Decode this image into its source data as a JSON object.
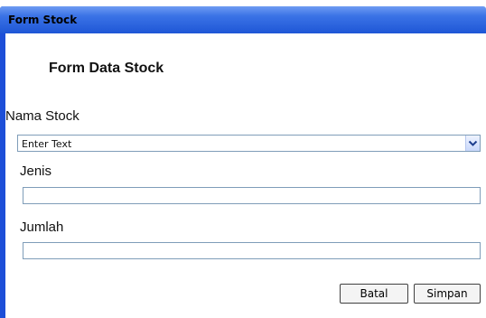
{
  "window": {
    "title": "Form Stock"
  },
  "form": {
    "heading": "Form Data Stock",
    "nama_stock": {
      "label": "Nama Stock",
      "value": "Enter Text"
    },
    "jenis": {
      "label": "Jenis",
      "value": ""
    },
    "jumlah": {
      "label": "Jumlah",
      "value": ""
    }
  },
  "buttons": {
    "cancel_label": "Batal",
    "save_label": "Simpan"
  },
  "icons": {
    "dropdown": "chevron-down-icon"
  },
  "colors": {
    "titlebar": "#1e56d6",
    "border": "#7f9db9"
  }
}
